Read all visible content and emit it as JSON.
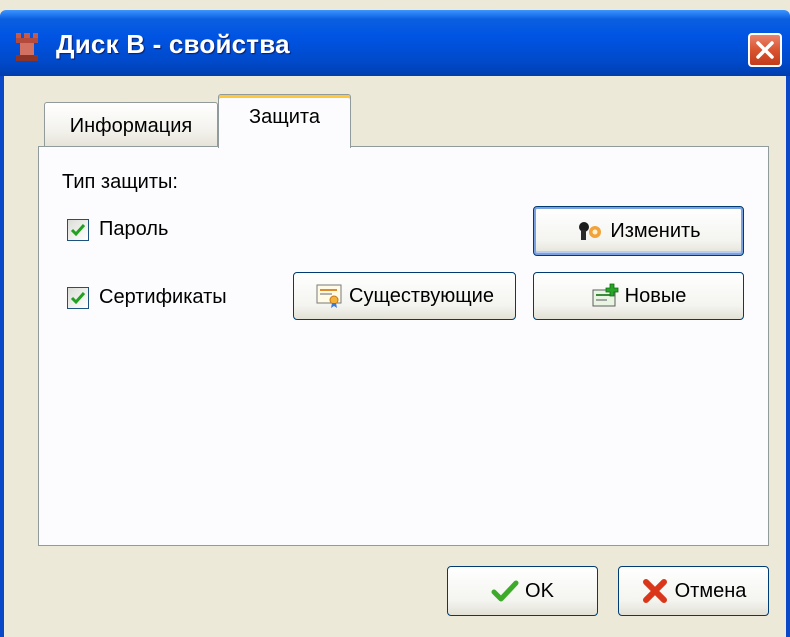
{
  "window": {
    "title": "Диск B - свойства",
    "accent": "#0054e3",
    "close_icon": "close-icon"
  },
  "tabs": [
    {
      "label": "Информация",
      "active": false
    },
    {
      "label": "Защита",
      "active": true
    }
  ],
  "security": {
    "type_label": "Тип защиты:",
    "password": {
      "label": "Пароль",
      "checked": true
    },
    "certificates": {
      "label": "Сертификаты",
      "checked": true
    },
    "change_button": {
      "label": "Изменить",
      "icon": "keys-icon"
    },
    "existing_button": {
      "label": "Существующие",
      "icon": "certificate-icon"
    },
    "new_button": {
      "label": "Новые",
      "icon": "new-certificate-icon"
    }
  },
  "footer": {
    "ok_label": "OK",
    "cancel_label": "Отмена",
    "ok_icon": "checkmark-icon",
    "cancel_icon": "cross-icon"
  }
}
